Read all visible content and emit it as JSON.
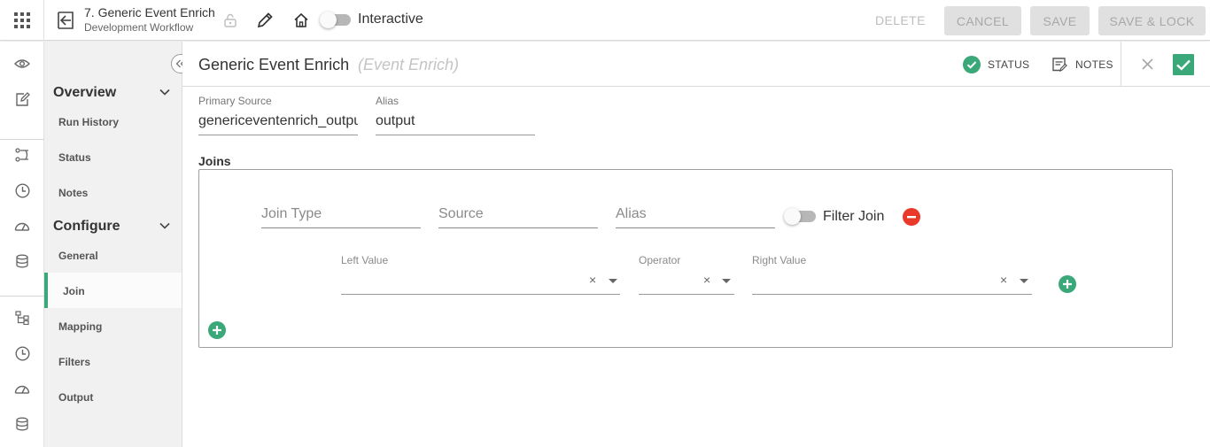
{
  "topbar": {
    "workflow_title": "7. Generic Event Enrich",
    "workflow_subtitle": "Development Workflow",
    "interactive_label": "Interactive",
    "delete_label": "DELETE",
    "cancel_label": "CANCEL",
    "save_label": "SAVE",
    "save_lock_label": "SAVE & LOCK"
  },
  "rail": {
    "icons": [
      "eye-icon",
      "edit-note-icon",
      "workflow-icon",
      "clock-icon",
      "gauge-icon",
      "database-icon",
      "hierarchy-icon",
      "clock-icon",
      "gauge-icon",
      "database-icon"
    ]
  },
  "nav": {
    "overview_label": "Overview",
    "overview_items": [
      "Run History",
      "Status",
      "Notes"
    ],
    "configure_label": "Configure",
    "configure_items": [
      "General",
      "Join",
      "Mapping",
      "Filters",
      "Output"
    ],
    "active_item": "Join"
  },
  "header": {
    "title": "Generic Event Enrich",
    "subtitle": "(Event Enrich)",
    "status_label": "STATUS",
    "notes_label": "NOTES",
    "accent_color": "#3aa878"
  },
  "form": {
    "primary_source_label": "Primary Source",
    "primary_source_value": "genericeventenrich_output",
    "alias_label": "Alias",
    "alias_value": "output",
    "joins_label": "Joins"
  },
  "join": {
    "join_type_placeholder": "Join Type",
    "source_placeholder": "Source",
    "alias_placeholder": "Alias",
    "filter_join_label": "Filter Join",
    "left_value_label": "Left Value",
    "operator_label": "Operator",
    "right_value_label": "Right Value",
    "clear_symbol": "×"
  }
}
